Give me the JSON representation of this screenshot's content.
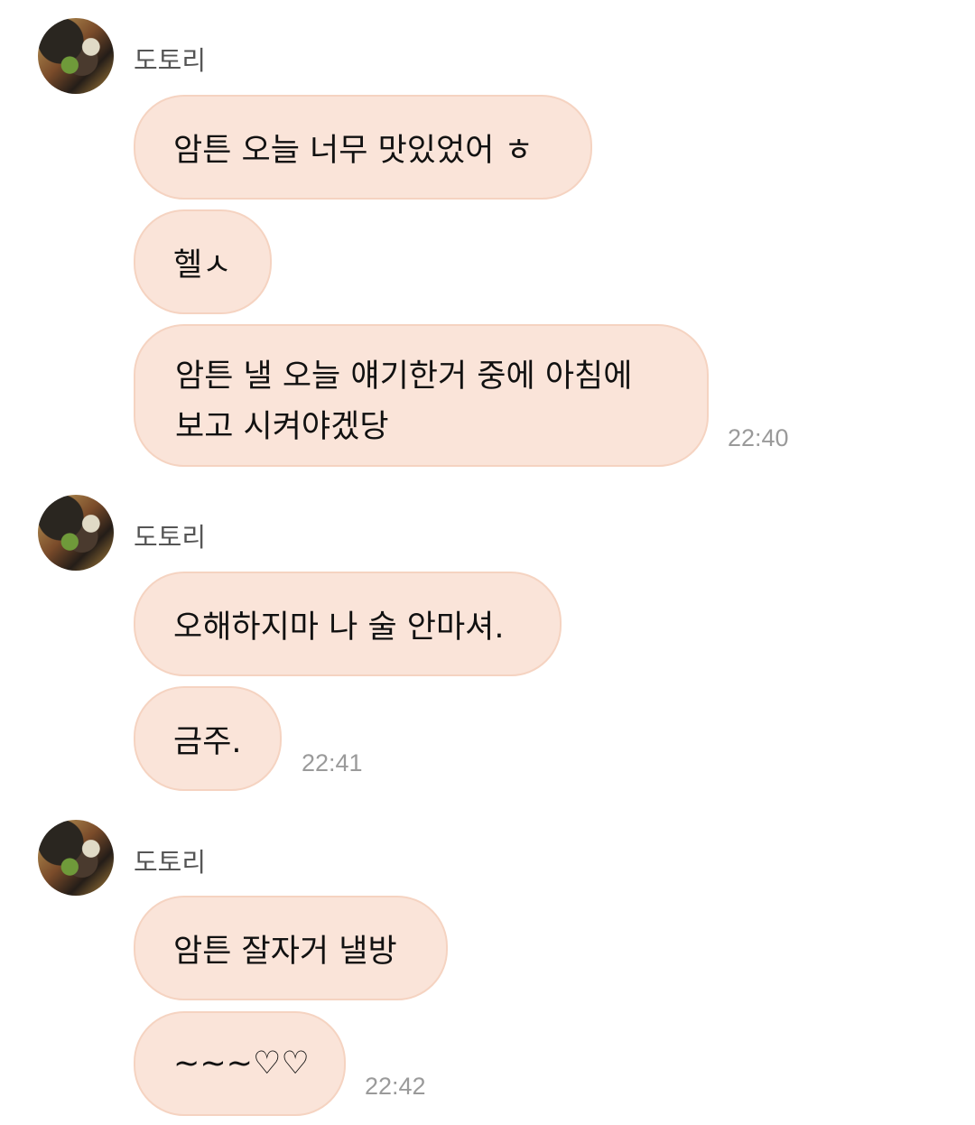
{
  "groups": [
    {
      "sender": "도토리",
      "messages": [
        {
          "text": "암튼 오늘 너무 맛있었어 ㅎ"
        },
        {
          "text": "헬ㅅ"
        },
        {
          "lines": [
            "암튼 낼 오늘 얘기한거 중에 아침에",
            "보고 시켜야겠당"
          ]
        }
      ],
      "time": "22:40"
    },
    {
      "sender": "도토리",
      "messages": [
        {
          "text": "오해하지마 나 술 안마셔."
        },
        {
          "text": "금주."
        }
      ],
      "time": "22:41"
    },
    {
      "sender": "도토리",
      "messages": [
        {
          "text": "암튼 잘자거 낼방"
        },
        {
          "text": "~~~♡♡"
        }
      ],
      "time": "22:42"
    }
  ],
  "colors": {
    "bubble": "#fae4d9",
    "bubble_border": "#f5d3c1",
    "sender_text": "#555555",
    "time_text": "#9a9a9a",
    "background": "#ffffff"
  }
}
